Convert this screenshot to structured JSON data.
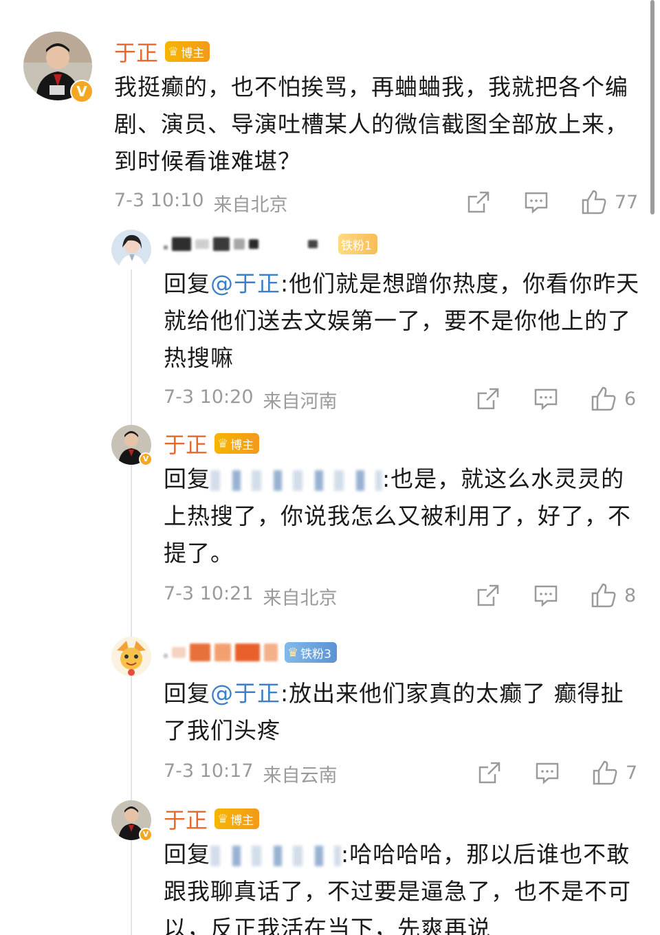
{
  "main_comment": {
    "author": "于正",
    "badge": "博主",
    "text": "我挺癫的，也不怕挨骂，再蛐蛐我，我就把各个编剧、演员、导演吐槽某人的微信截图全部放上来，到时候看谁难堪？",
    "time": "7-3 10:10",
    "location": "来自北京",
    "likes": "77"
  },
  "replies": [
    {
      "badge": "铁粉1",
      "reply_prefix": "回复",
      "mention": "@于正",
      "text": ":他们就是想蹭你热度，你看你昨天就给他们送去文娱第一了，要不是你他上的了热搜嘛",
      "time": "7-3 10:20",
      "location": "来自河南",
      "likes": "6"
    },
    {
      "author": "于正",
      "badge": "博主",
      "reply_prefix": "回复",
      "text": ":也是，就这么水灵灵的上热搜了，你说我怎么又被利用了，好了，不提了。",
      "time": "7-3 10:21",
      "location": "来自北京",
      "likes": "8"
    },
    {
      "badge": "铁粉3",
      "reply_prefix": "回复",
      "mention": "@于正",
      "text": ":放出来他们家真的太癫了 癫得扯了我们头疼",
      "time": "7-3 10:17",
      "location": "来自云南",
      "likes": "7"
    },
    {
      "author": "于正",
      "badge": "博主",
      "reply_prefix": "回复",
      "text": ":哈哈哈哈，那以后谁也不敢跟我聊真话了，不过要是逼急了，也不是不可以，反正我活在当下，先爽再说"
    }
  ],
  "icons": [
    "share-icon",
    "comment-icon",
    "like-icon"
  ],
  "colors": {
    "author": "#e8672a",
    "mention": "#3b7fc9",
    "meta": "#9a9a9a"
  }
}
